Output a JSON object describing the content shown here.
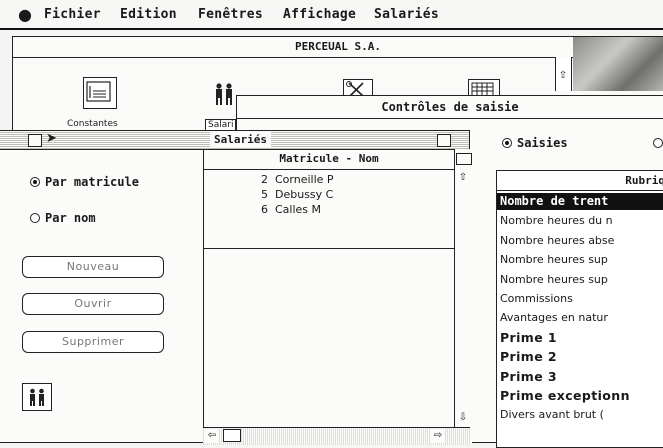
{
  "menubar": {
    "apple": "",
    "items": [
      "Fichier",
      "Edition",
      "Fenêtres",
      "Affichage",
      "Salariés"
    ]
  },
  "desktop_window": {
    "title": "PERCEUAL S.A.",
    "icons": [
      {
        "name": "constantes-icon",
        "label": "Constantes"
      },
      {
        "name": "salaries-icon",
        "label": "Salari"
      },
      {
        "name": "tools-icon",
        "label": ""
      },
      {
        "name": "calendar-icon",
        "label": ""
      }
    ]
  },
  "controles_window": {
    "title": "Contrôles de saisie",
    "radio_saisies": "Saisies",
    "rubriques_header": "Rubriq",
    "rubriques": [
      {
        "label": "Nombre de trent",
        "style": "selected"
      },
      {
        "label": "Nombre heures du n",
        "style": "normal"
      },
      {
        "label": "Nombre heures abse",
        "style": "normal"
      },
      {
        "label": "Nombre heures sup",
        "style": "normal"
      },
      {
        "label": "Nombre heures sup",
        "style": "normal"
      },
      {
        "label": "Commissions",
        "style": "normal"
      },
      {
        "label": "Avantages en natur",
        "style": "normal"
      },
      {
        "label": "Prime 1",
        "style": "bold"
      },
      {
        "label": "Prime 2",
        "style": "bold"
      },
      {
        "label": "Prime 3",
        "style": "bold"
      },
      {
        "label": "Prime exceptionn",
        "style": "bold"
      },
      {
        "label": "Divers avant brut (",
        "style": "normal"
      }
    ]
  },
  "salaries_window": {
    "title": "Salariés",
    "radio_matricule": "Par matricule",
    "radio_nom": "Par nom",
    "buttons": {
      "nouveau": "Nouveau",
      "ouvrir": "Ouvrir",
      "supprimer": "Supprimer"
    },
    "list_header": "Matricule - Nom",
    "list": [
      {
        "num": "2",
        "name": "Corneille P"
      },
      {
        "num": "5",
        "name": "Debussy C"
      },
      {
        "num": "6",
        "name": "Calles M"
      }
    ]
  }
}
